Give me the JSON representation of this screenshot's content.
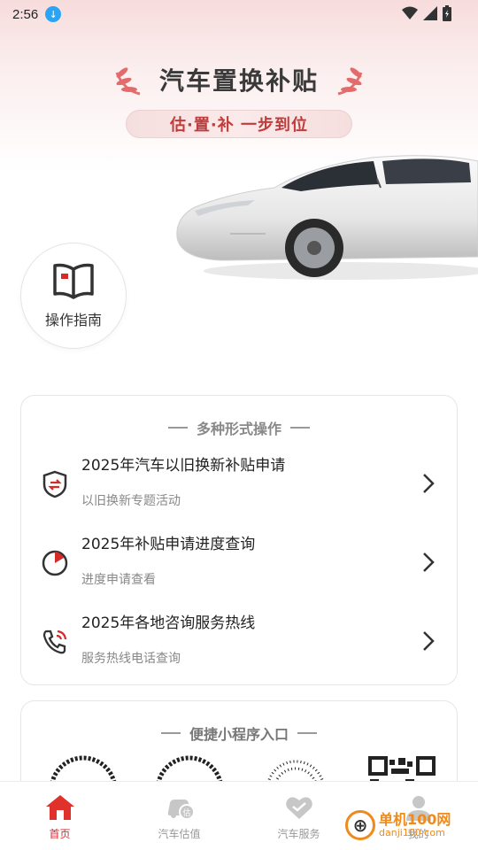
{
  "status_bar": {
    "time": "2:56"
  },
  "hero": {
    "title": "汽车置换补贴",
    "subtitle": "估·置·补 一步到位"
  },
  "guide": {
    "label": "操作指南",
    "icon": "book-icon"
  },
  "section1": {
    "heading": "多种形式操作",
    "rows": [
      {
        "title": "2025年汽车以旧换新补贴申请",
        "sub": "以旧换新专题活动",
        "icon": "shield-exchange-icon"
      },
      {
        "title": "2025年补贴申请进度查询",
        "sub": "进度申请查看",
        "icon": "progress-clock-icon"
      },
      {
        "title": "2025年各地咨询服务热线",
        "sub": "服务热线电话查询",
        "icon": "phone-call-icon"
      }
    ]
  },
  "section2": {
    "heading": "便捷小程序入口"
  },
  "tabs": [
    {
      "label": "首页",
      "icon": "home-icon",
      "active": true
    },
    {
      "label": "汽车估值",
      "icon": "car-valuation-icon",
      "active": false
    },
    {
      "label": "汽车服务",
      "icon": "handshake-icon",
      "active": false
    },
    {
      "label": "我的",
      "icon": "user-icon",
      "active": false
    }
  ],
  "watermark": {
    "brand": "单机100网",
    "url": "danji100.com"
  },
  "colors": {
    "accent": "#d32a2a",
    "text": "#222222",
    "muted": "#888888"
  }
}
